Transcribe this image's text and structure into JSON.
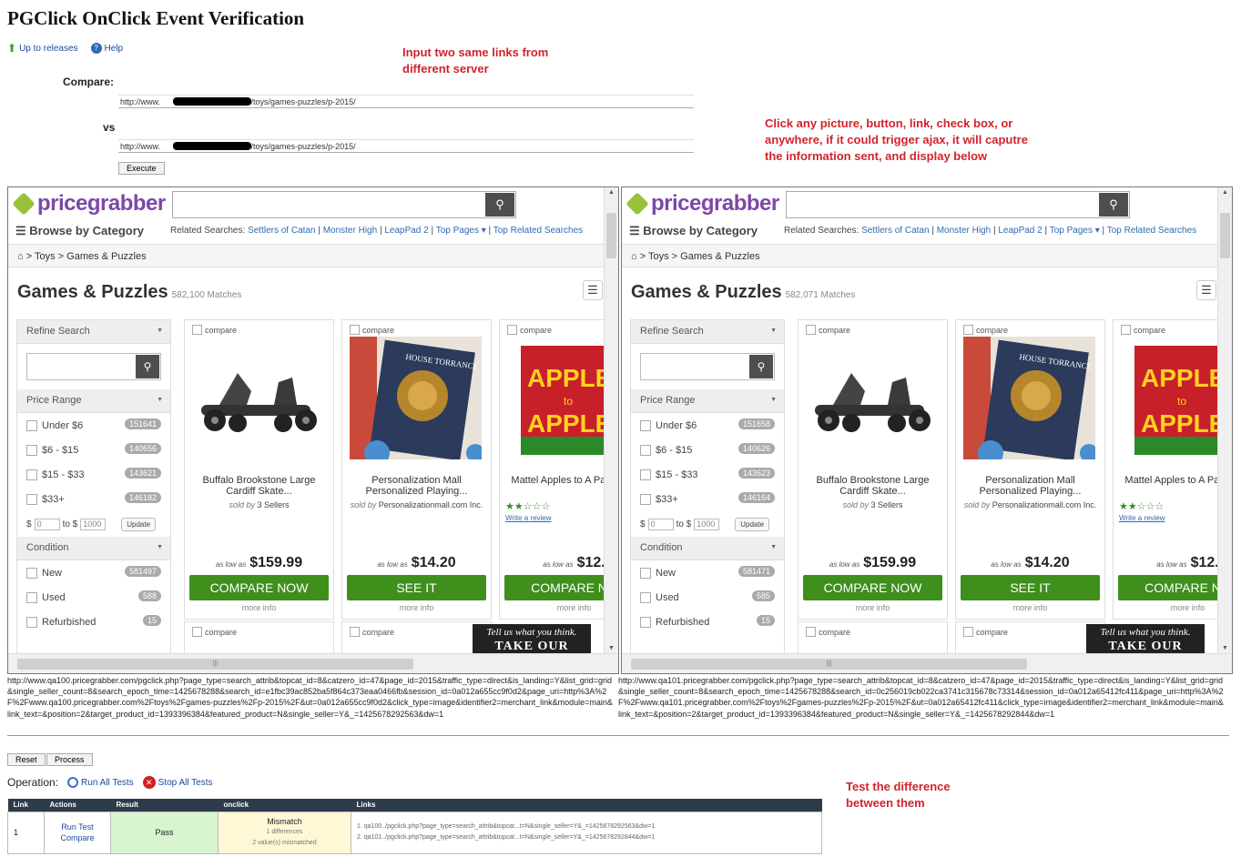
{
  "page": {
    "title": "PGClick OnClick Event Verification",
    "up_link": "Up to releases",
    "help_link": "Help",
    "note_input": "Input two same links from different server",
    "note_click": "Click any picture, button, link, check box, or anywhere, if it could trigger ajax, it will caputre the information sent, and display below",
    "note_test": "Test the difference between them",
    "compare_label": "Compare:",
    "vs_label": "vs",
    "url1": "http://www.                                .com/toys/games-puzzles/p-2015/",
    "url2": "http://www.                                .com/toys/games-puzzles/p-2015/",
    "execute_label": "Execute",
    "reset_label": "Reset",
    "process_label": "Process",
    "operation_label": "Operation:",
    "run_all_label": "Run All Tests",
    "stop_all_label": "Stop All Tests"
  },
  "site": {
    "logo": "pricegrabber",
    "browse": "Browse by Category",
    "related_label": "Related Searches:",
    "related": [
      "Settlers of Catan",
      "Monster High",
      "LeapPad 2",
      "Top Pages ▾",
      "Top Related Searches"
    ],
    "crumb": "> Toys > Games & Puzzles",
    "cat_title": "Games & Puzzles",
    "refine_search": "Refine Search",
    "price_range": "Price Range",
    "price_from": "0",
    "price_to_label": "to $",
    "price_to": "1000",
    "update": "Update",
    "condition": "Condition",
    "cond_new": "New",
    "cond_used": "Used",
    "cond_refurb": "Refurbished",
    "compare": "compare",
    "as_low_as": "as low as",
    "more_info": "more info",
    "write_review": "Write a review",
    "survey1": "Tell us what you think.",
    "survey2": "TAKE OUR SURVEY"
  },
  "frames": [
    {
      "matches": "582,100 Matches",
      "price_ranges": [
        {
          "label": "Under $6",
          "count": "151641"
        },
        {
          "label": "$6 - $15",
          "count": "140656"
        },
        {
          "label": "$15 - $33",
          "count": "143621"
        },
        {
          "label": "$33+",
          "count": "146182"
        }
      ],
      "cond_counts": [
        "581497",
        "588",
        "15"
      ],
      "captured": "http://www.qa100.pricegrabber.com/pgclick.php?page_type=search_attrib&topcat_id=8&catzero_id=47&page_id=2015&traffic_type=direct&is_landing=Y&list_grid=grid&single_seller_count=8&search_epoch_time=1425678288&search_id=e1fbc39ac852ba5f864c373eaa0466fb&session_id=0a012a655cc9f0d2&page_uri=http%3A%2F%2Fwww.qa100.pricegrabber.com%2Ftoys%2Fgames-puzzles%2Fp-2015%2F&ut=0a012a655cc9f0d2&click_type=image&identifier2=merchant_link&module=main&link_text=&position=2&target_product_id=1393396384&featured_product=N&single_seller=Y&_=1425678292563&dw=1"
    },
    {
      "matches": "582,071 Matches",
      "price_ranges": [
        {
          "label": "Under $6",
          "count": "151658"
        },
        {
          "label": "$6 - $15",
          "count": "140626"
        },
        {
          "label": "$15 - $33",
          "count": "143623"
        },
        {
          "label": "$33+",
          "count": "146164"
        }
      ],
      "cond_counts": [
        "581471",
        "585",
        "15"
      ],
      "captured": "http://www.qa101.pricegrabber.com/pgclick.php?page_type=search_attrib&topcat_id=8&catzero_id=47&page_id=2015&traffic_type=direct&is_landing=Y&list_grid=grid&single_seller_count=8&search_epoch_time=1425678288&search_id=0c256019cb022ca3741c315678c73314&session_id=0a012a65412fc411&page_uri=http%3A%2F%2Fwww.qa101.pricegrabber.com%2Ftoys%2Fgames-puzzles%2Fp-2015%2F&ut=0a012a65412fc411&click_type=image&identifier2=merchant_link&module=main&link_text=&position=2&target_product_id=1393396384&featured_product=N&single_seller=Y&_=1425678292844&dw=1"
    }
  ],
  "products": [
    {
      "name": "Buffalo Brookstone Large Cardiff Skate...",
      "sold_by": "sold by",
      "seller": "3 Sellers",
      "price": "$159.99",
      "cta": "COMPARE NOW"
    },
    {
      "name": "Personalization Mall Personalized Playing...",
      "sold_by": "sold by",
      "seller": "Personalizationmall.com Inc.",
      "price": "$14.20",
      "cta": "SEE IT"
    },
    {
      "name": "Mattel Apples to A Party Box",
      "sold_by": "sold",
      "seller": "6 Sel",
      "price": "$12.",
      "cta": "COMPARE NO"
    }
  ],
  "results": {
    "headers": [
      "Link",
      "Actions",
      "Result",
      "onclick",
      "Links"
    ],
    "row": {
      "link": "1",
      "run_test": "Run Test",
      "compare": "Compare",
      "result": "Pass",
      "onclick_status": "Mismatch",
      "onclick_diff": "1 differences",
      "onclick_values": "2 value(s) mismatched",
      "link1": "1. qa100../pgclick.php?page_type=search_attrib&topcat...t=N&single_seller=Y&_=1425678292563&dw=1",
      "link2": "2. qa101../pgclick.php?page_type=search_attrib&topcat...t=N&single_seller=Y&_=1425678292844&dw=1"
    }
  },
  "colors": {
    "note": "#d0242b",
    "brand": "#7c48a8",
    "cta": "#3e8f1c",
    "table_header": "#2d3b4a",
    "pass": "#d8f5cf",
    "mismatch": "#fff8d6"
  },
  "icons": [
    "up-arrow-icon",
    "help-icon",
    "search-icon",
    "menu-icon",
    "home-icon",
    "run-icon",
    "stop-icon"
  ]
}
